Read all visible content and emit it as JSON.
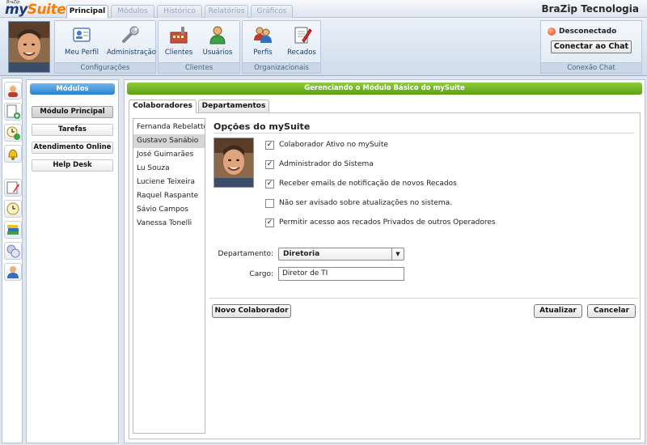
{
  "app": {
    "logo_small": "BraZip",
    "logo_prefix": "my",
    "logo_suffix": "Suite",
    "brand": "BraZip Tecnologia"
  },
  "top_tabs": [
    {
      "label": "Principal",
      "active": true
    },
    {
      "label": "Módulos"
    },
    {
      "label": "Histórico"
    },
    {
      "label": "Relatórios"
    },
    {
      "label": "Gráficos"
    }
  ],
  "ribbon": {
    "groups": [
      {
        "label": "Configurações",
        "buttons": [
          {
            "label": "Meu Perfil",
            "icon": "profile-card-icon"
          },
          {
            "label": "Administração",
            "icon": "wrench-icon"
          }
        ]
      },
      {
        "label": "Clientes",
        "buttons": [
          {
            "label": "Clientes",
            "icon": "factory-icon"
          },
          {
            "label": "Usuários",
            "icon": "user-icon"
          }
        ]
      },
      {
        "label": "Organizacionais",
        "buttons": [
          {
            "label": "Perfis",
            "icon": "users-group-icon"
          },
          {
            "label": "Recados",
            "icon": "notepad-icon"
          }
        ]
      }
    ],
    "chat": {
      "status": "Desconectado",
      "button": "Conectar ao Chat",
      "label": "Conexão Chat",
      "status_color": "#e4431a"
    }
  },
  "modules": {
    "header": "Módulos",
    "items": [
      "Módulo Principal",
      "Tarefas",
      "Atendimento Online",
      "Help Desk"
    ],
    "active": "Módulo Principal"
  },
  "main": {
    "header": "Gerenciando o Módulo Básico do mySuite",
    "tabs": [
      {
        "label": "Colaboradores",
        "active": true
      },
      {
        "label": "Departamentos"
      }
    ],
    "users": [
      "Fernanda Rebelatto",
      "Gustavo Sanábio",
      "José Guimarães",
      "Lu Souza",
      "Luciene Teixeira",
      "Raquel Raspante",
      "Sávio Campos",
      "Vanessa Tonelli"
    ],
    "selected_user": "Gustavo Sanábio",
    "options_title": "Opções do mySuite",
    "options": [
      {
        "label": "Colaborador Ativo no mySuite",
        "checked": true
      },
      {
        "label": "Administrador do Sistema",
        "checked": true
      },
      {
        "label": "Receber emails de notificação de novos Recados",
        "checked": true
      },
      {
        "label": "Não ser avisado sobre atualizações no sistema.",
        "checked": false
      },
      {
        "label": "Permitir acesso aos recados Privados de outros Operadores",
        "checked": true
      }
    ],
    "department_label": "Departamento:",
    "department_value": "Diretoria",
    "cargo_label": "Cargo:",
    "cargo_value": "Diretor de TI",
    "buttons": {
      "new": "Novo Colaborador",
      "update": "Atualizar",
      "cancel": "Cancelar"
    }
  },
  "colors": {
    "accent_blue": "#2c83cf",
    "accent_green": "#5e9f12",
    "logo_orange": "#ff7b00"
  }
}
